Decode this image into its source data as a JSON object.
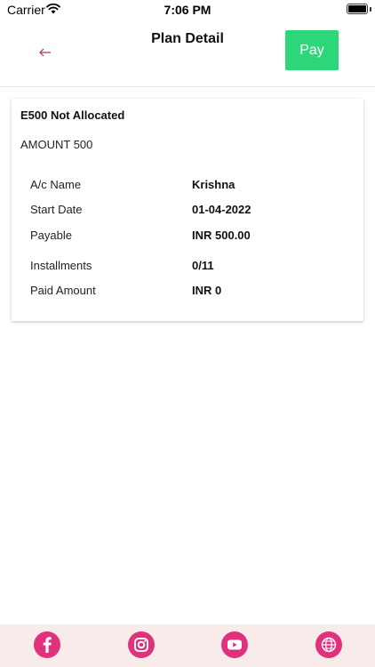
{
  "status_bar": {
    "carrier": "Carrier",
    "time": "7:06 PM"
  },
  "header": {
    "title": "Plan Detail",
    "back_icon": "arrow-left-icon",
    "pay_label": "Pay",
    "pay_color": "#2ed67a",
    "accent_color": "#b0334e"
  },
  "plan": {
    "name": "E500 Not Allocated",
    "amount": "AMOUNT 500",
    "details": [
      {
        "label": "A/c Name",
        "value": "Krishna"
      },
      {
        "label": "Start Date",
        "value": "01-04-2022"
      },
      {
        "label": "Payable",
        "value": "INR 500.00"
      },
      {
        "label": "Installments",
        "value": "0/11"
      },
      {
        "label": "Paid Amount",
        "value": "INR 0"
      }
    ]
  },
  "footer": {
    "background": "#f7ece9",
    "icon_color": "#e0317c",
    "icons": [
      "facebook-icon",
      "instagram-icon",
      "youtube-icon",
      "globe-icon"
    ]
  }
}
